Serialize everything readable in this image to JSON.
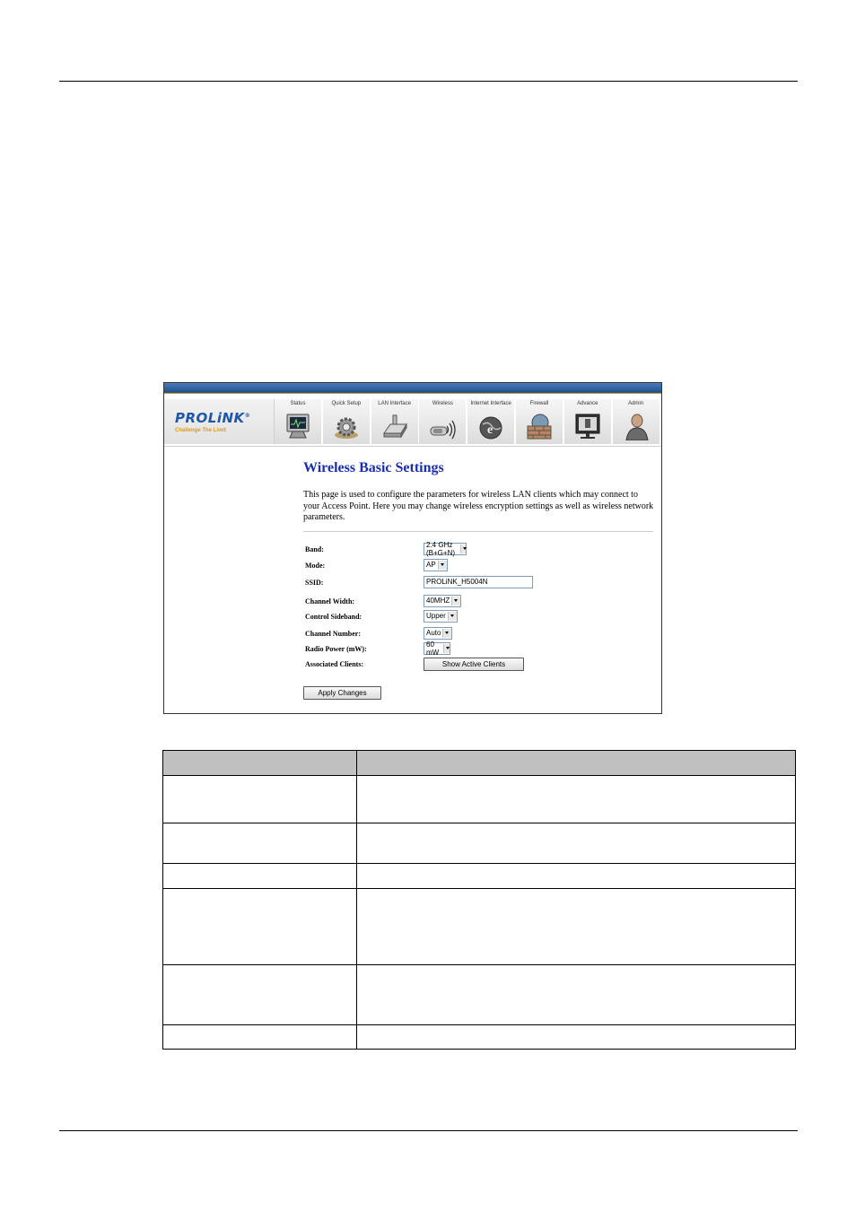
{
  "router_ui": {
    "brand": {
      "logo": "PROLiNK",
      "registered": "®",
      "tagline": "Challenge The Limit"
    },
    "nav": [
      {
        "label": "Status",
        "icon": "monitor-icon"
      },
      {
        "label": "Quick Setup",
        "icon": "gear-icon"
      },
      {
        "label": "LAN Interface",
        "icon": "router-icon"
      },
      {
        "label": "Wireless",
        "icon": "wireless-icon"
      },
      {
        "label": "Internet Interface",
        "icon": "internet-globe-icon"
      },
      {
        "label": "Firewall",
        "icon": "firewall-icon"
      },
      {
        "label": "Advance",
        "icon": "advance-icon"
      },
      {
        "label": "Admin",
        "icon": "admin-user-icon"
      }
    ],
    "page_title": "Wireless Basic Settings",
    "description": "This page is used to configure the parameters for wireless LAN clients which may connect to your Access Point. Here you may change wireless encryption settings as well as wireless network parameters.",
    "form": {
      "band": {
        "label": "Band:",
        "value": "2.4 GHz (B+G+N)"
      },
      "mode": {
        "label": "Mode:",
        "value": "AP"
      },
      "ssid": {
        "label": "SSID:",
        "value": "PROLiNK_H5004N"
      },
      "channel_width": {
        "label": "Channel Width:",
        "value": "40MHZ"
      },
      "control_sideband": {
        "label": "Control Sideband:",
        "value": "Upper"
      },
      "channel_number": {
        "label": "Channel Number:",
        "value": "Auto"
      },
      "radio_power": {
        "label": "Radio Power (mW):",
        "value": "60 mW"
      },
      "associated_clients": {
        "label": "Associated Clients:",
        "button": "Show Active Clients"
      }
    },
    "apply_button": "Apply Changes"
  },
  "table": {
    "headers": [
      "",
      ""
    ],
    "rows": [
      {
        "a": "",
        "b": ""
      },
      {
        "a": "",
        "b": ""
      },
      {
        "a": "",
        "b": ""
      },
      {
        "a": "",
        "b": ""
      },
      {
        "a": "",
        "b": ""
      },
      {
        "a": "",
        "b": ""
      }
    ]
  }
}
